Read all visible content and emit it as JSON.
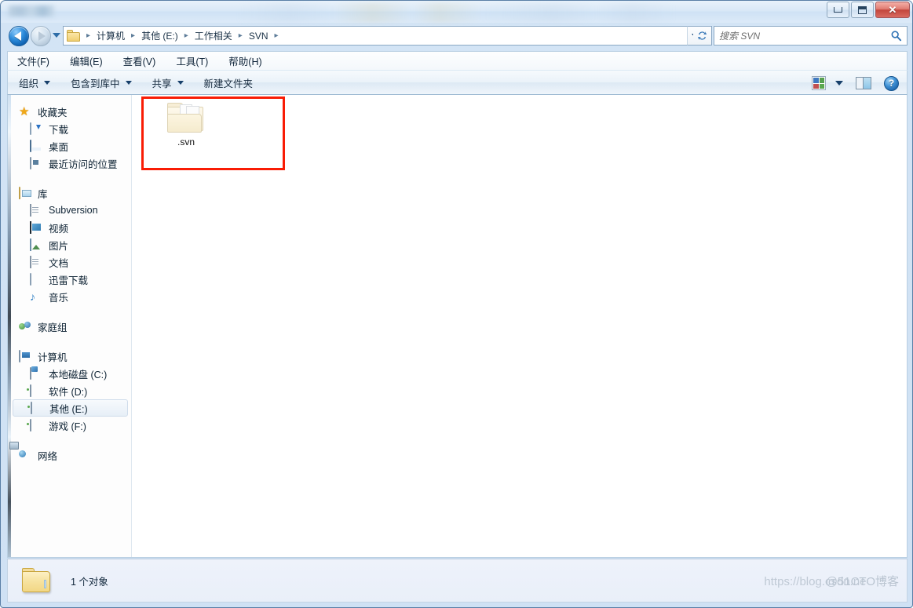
{
  "window": {
    "title": "",
    "controls": {
      "minimize": "minimize",
      "maximize": "maximize",
      "close": "✕"
    }
  },
  "address_bar": {
    "back_tooltip": "back",
    "forward_tooltip": "forward",
    "breadcrumbs": [
      "计算机",
      "其他 (E:)",
      "工作相关",
      "SVN"
    ],
    "separator": "▸",
    "dropdown_icon": "chevron-down-icon",
    "refresh_icon": "refresh-icon"
  },
  "search": {
    "placeholder": "搜索 SVN",
    "value": "",
    "icon": "search-icon"
  },
  "menubar": {
    "items": [
      {
        "label": "文件(F)",
        "text": "文件(",
        "key": "F",
        "tail": ")"
      },
      {
        "label": "编辑(E)",
        "text": "编辑(",
        "key": "E",
        "tail": ")"
      },
      {
        "label": "查看(V)",
        "text": "查看(",
        "key": "V",
        "tail": ")"
      },
      {
        "label": "工具(T)",
        "text": "工具(",
        "key": "T",
        "tail": ")"
      },
      {
        "label": "帮助(H)",
        "text": "帮助(",
        "key": "H",
        "tail": ")"
      }
    ]
  },
  "toolbar": {
    "organize": "组织",
    "include_in_library": "包含到库中",
    "share": "共享",
    "new_folder": "新建文件夹",
    "view_icon": "view-options-icon",
    "preview_pane_icon": "preview-pane-icon",
    "help_icon": "help-icon",
    "help_glyph": "?"
  },
  "sidebar": {
    "groups": [
      {
        "header": {
          "label": "收藏夹",
          "icon": "favorites-star-icon"
        },
        "items": [
          {
            "label": "下载",
            "icon": "downloads-icon"
          },
          {
            "label": "桌面",
            "icon": "desktop-icon"
          },
          {
            "label": "最近访问的位置",
            "icon": "recent-places-icon"
          }
        ]
      },
      {
        "header": {
          "label": "库",
          "icon": "libraries-icon"
        },
        "items": [
          {
            "label": "Subversion",
            "icon": "document-library-icon"
          },
          {
            "label": "视频",
            "icon": "videos-icon"
          },
          {
            "label": "图片",
            "icon": "pictures-icon"
          },
          {
            "label": "文档",
            "icon": "documents-icon"
          },
          {
            "label": "迅雷下载",
            "icon": "thunder-download-icon"
          },
          {
            "label": "音乐",
            "icon": "music-icon"
          }
        ]
      },
      {
        "header": {
          "label": "家庭组",
          "icon": "homegroup-icon"
        },
        "items": []
      },
      {
        "header": {
          "label": "计算机",
          "icon": "computer-icon"
        },
        "items": [
          {
            "label": "本地磁盘 (C:)",
            "icon": "system-drive-icon",
            "selected": false
          },
          {
            "label": "软件 (D:)",
            "icon": "drive-icon",
            "selected": false
          },
          {
            "label": "其他 (E:)",
            "icon": "drive-icon",
            "selected": true
          },
          {
            "label": "游戏 (F:)",
            "icon": "drive-icon",
            "selected": false
          }
        ]
      },
      {
        "header": {
          "label": "网络",
          "icon": "network-icon"
        },
        "items": []
      }
    ]
  },
  "content": {
    "files": [
      {
        "name": ".svn",
        "icon": "folder-icon",
        "hidden": true
      }
    ],
    "annotation": {
      "type": "red-rectangle",
      "color": "#f91c05"
    }
  },
  "statusbar": {
    "icon": "folder-icon",
    "text": "1 个对象"
  },
  "watermark": {
    "line1": "https://blog.csdn.ne",
    "line2": "@51CTO博客"
  },
  "colors": {
    "accent": "#2e8ddc",
    "annotation": "#f91c05",
    "close_button": "#c3453c",
    "selected_row": "#e7eff7"
  }
}
